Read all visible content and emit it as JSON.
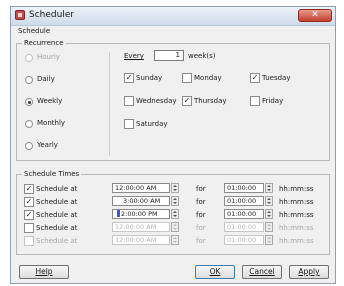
{
  "window": {
    "title": "Scheduler",
    "close_glyph": "✕"
  },
  "schedule_label": "Schedule",
  "recurrence": {
    "legend": "Recurrence",
    "options": [
      {
        "label": "Hourly",
        "selected": false,
        "disabled": true
      },
      {
        "label": "Daily",
        "selected": false,
        "disabled": false
      },
      {
        "label": "Weekly",
        "selected": true,
        "disabled": false
      },
      {
        "label": "Monthly",
        "selected": false,
        "disabled": false
      },
      {
        "label": "Yearly",
        "selected": false,
        "disabled": false
      }
    ],
    "every_label": "Every",
    "every_value": "1",
    "every_unit": "week(s)",
    "days": [
      {
        "label": "Sunday",
        "checked": true
      },
      {
        "label": "Monday",
        "checked": false
      },
      {
        "label": "Tuesday",
        "checked": true
      },
      {
        "label": "Wednesday",
        "checked": false
      },
      {
        "label": "Thursday",
        "checked": true
      },
      {
        "label": "Friday",
        "checked": false
      },
      {
        "label": "Saturday",
        "checked": false
      }
    ]
  },
  "schedule_times": {
    "legend": "Schedule Times",
    "for_label": "for",
    "format_label": "hh:mm:ss",
    "rows": [
      {
        "label": "Schedule at",
        "checked": true,
        "disabled": false,
        "time": "12:00:00 AM",
        "duration": "01:00:00"
      },
      {
        "label": "Schedule at",
        "checked": true,
        "disabled": false,
        "time": "3:00:00 AM",
        "duration": "01:00:00"
      },
      {
        "label": "Schedule at",
        "checked": true,
        "disabled": false,
        "time": "2:00:00 PM",
        "duration": "01:00:00"
      },
      {
        "label": "Schedule at",
        "checked": false,
        "disabled": false,
        "time": "12:00:00 AM",
        "duration": "01:00:00"
      },
      {
        "label": "Schedule at",
        "checked": false,
        "disabled": true,
        "time": "12:00:00 AM",
        "duration": "01:00:00"
      }
    ]
  },
  "buttons": {
    "help": "Help",
    "ok": "OK",
    "cancel": "Cancel",
    "apply": "Apply"
  },
  "colors": {
    "titlebar": "#dbe5f1",
    "close_button": "#c2402e",
    "dialog_bg": "#f0f0f0",
    "selection_cursor": "#3b5bd6"
  },
  "icons": {
    "app": "scheduler-app-icon",
    "close": "close-icon",
    "spinner": "spinner-arrows-icon"
  }
}
